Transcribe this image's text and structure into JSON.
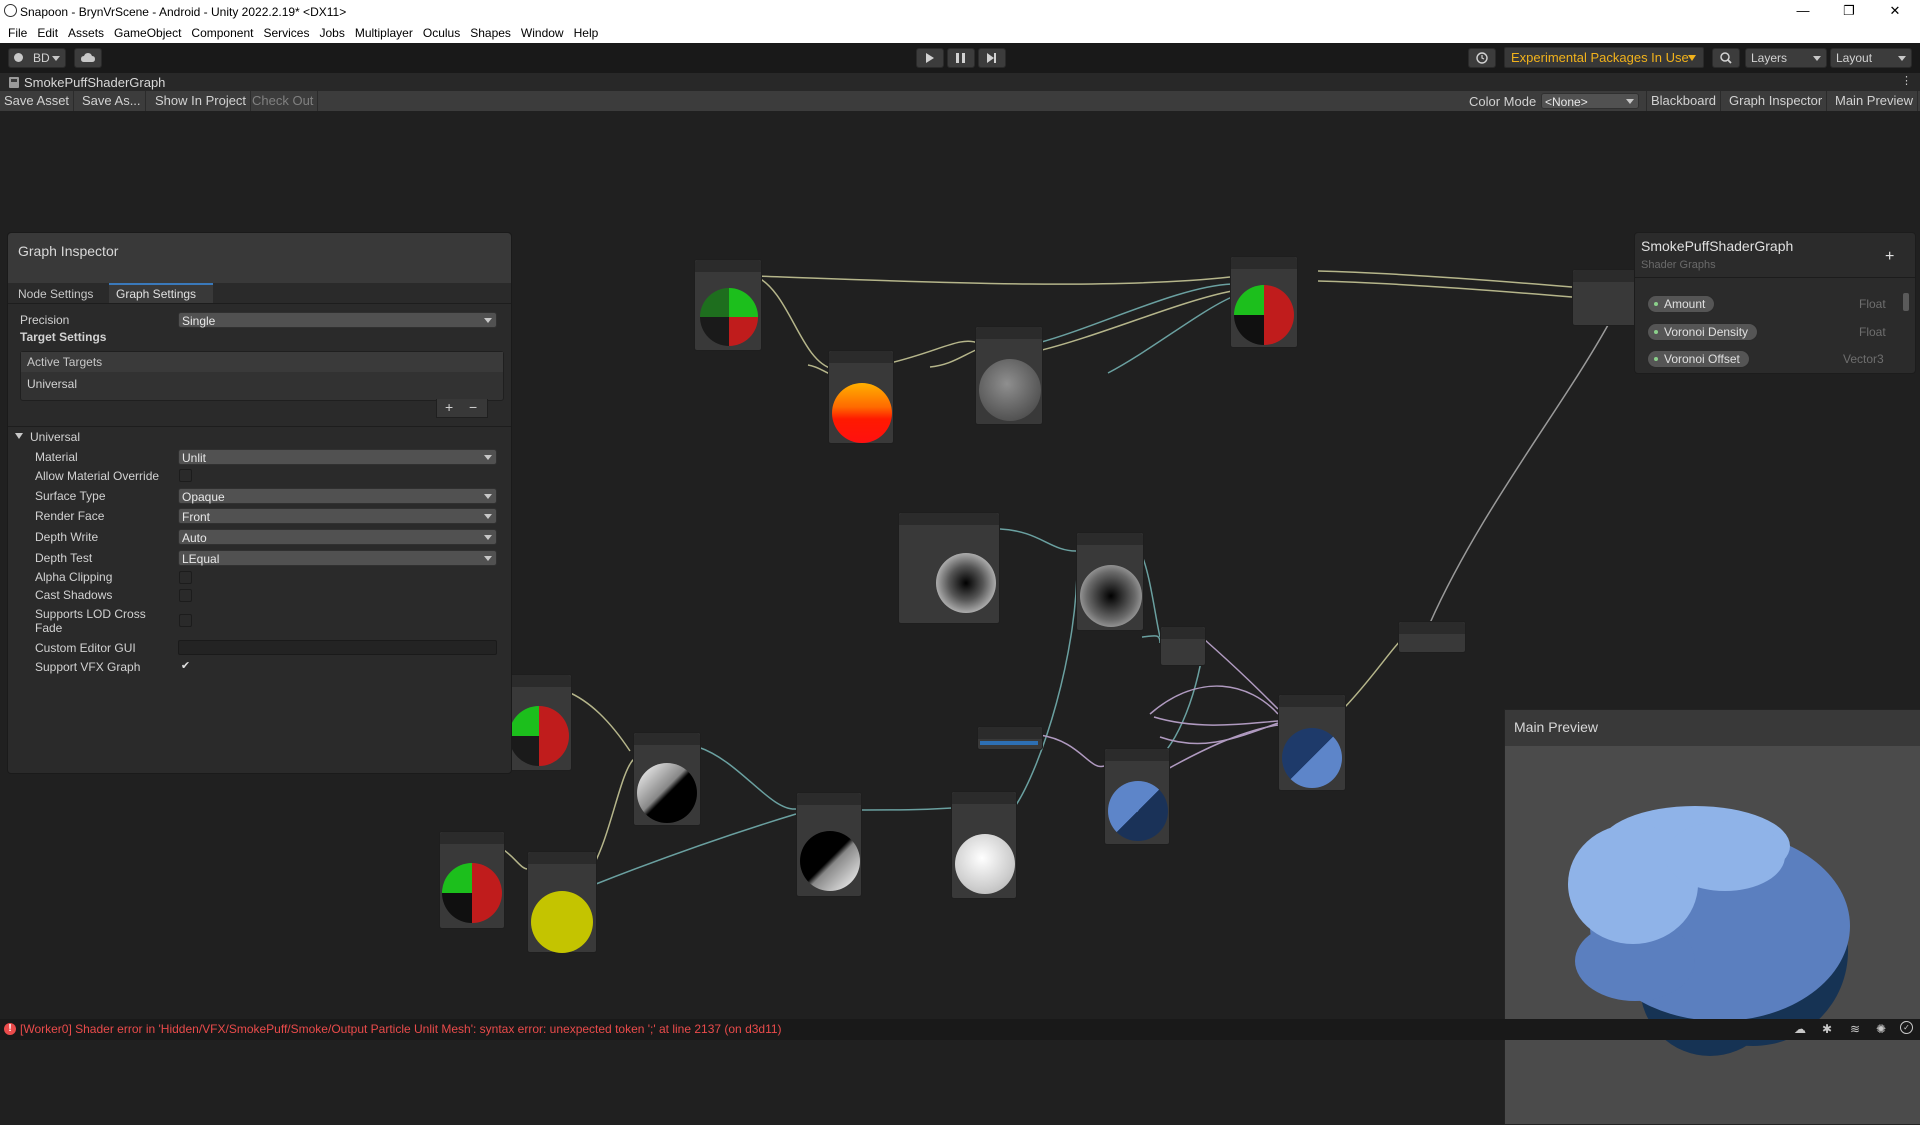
{
  "window": {
    "title": "Snapoon - BrynVrScene - Android - Unity 2022.2.19* <DX11>",
    "controls": [
      "—",
      "❐",
      "✕"
    ]
  },
  "menu": [
    "File",
    "Edit",
    "Assets",
    "GameObject",
    "Component",
    "Services",
    "Jobs",
    "Multiplayer",
    "Oculus",
    "Shapes",
    "Window",
    "Help"
  ],
  "toolbar": {
    "account": "BD",
    "experimental": "Experimental Packages In Use",
    "layers": "Layers",
    "layout": "Layout"
  },
  "tab": {
    "title": "SmokePuffShaderGraph"
  },
  "shader_toolbar": {
    "save_asset": "Save Asset",
    "save_as": "Save As...",
    "show_in_project": "Show In Project",
    "check_out": "Check Out",
    "color_mode_label": "Color Mode",
    "color_mode_value": "<None>",
    "blackboard": "Blackboard",
    "graph_inspector": "Graph Inspector",
    "main_preview": "Main Preview"
  },
  "inspector": {
    "title": "Graph Inspector",
    "tabs": [
      "Node Settings",
      "Graph Settings"
    ],
    "active_tab": "Graph Settings",
    "precision_label": "Precision",
    "precision_value": "Single",
    "target_settings": "Target Settings",
    "active_targets": "Active Targets",
    "target_item": "Universal",
    "add_btn": "+",
    "remove_btn": "−",
    "universal_header": "Universal",
    "props": {
      "material": {
        "label": "Material",
        "value": "Unlit"
      },
      "allow_override": {
        "label": "Allow Material Override",
        "checked": false
      },
      "surface_type": {
        "label": "Surface Type",
        "value": "Opaque"
      },
      "render_face": {
        "label": "Render Face",
        "value": "Front"
      },
      "depth_write": {
        "label": "Depth Write",
        "value": "Auto"
      },
      "depth_test": {
        "label": "Depth Test",
        "value": "LEqual"
      },
      "alpha_clipping": {
        "label": "Alpha Clipping",
        "checked": false
      },
      "cast_shadows": {
        "label": "Cast Shadows",
        "checked": false
      },
      "lod_cross_fade": {
        "label": "Supports LOD Cross Fade",
        "checked": false
      },
      "custom_editor": {
        "label": "Custom Editor GUI",
        "value": ""
      },
      "support_vfx": {
        "label": "Support VFX Graph",
        "checked": true
      }
    }
  },
  "blackboard": {
    "title": "SmokePuffShaderGraph",
    "subtitle": "Shader Graphs",
    "add": "+",
    "properties": [
      {
        "name": "Amount",
        "type": "Float"
      },
      {
        "name": "Voronoi Density",
        "type": "Float"
      },
      {
        "name": "Voronoi Offset",
        "type": "Vector3"
      }
    ]
  },
  "preview": {
    "title": "Main Preview",
    "colors": {
      "light": "#8fb3e8",
      "mid": "#5b7fbf",
      "dark": "#163354"
    }
  },
  "status": {
    "error": "[Worker0] Shader error in 'Hidden/VFX/SmokePuff/Smoke/Output Particle Unlit Mesh': syntax error: unexpected token ';' at line 2137 (on d3d11)",
    "error_color": "#e94b4b"
  }
}
